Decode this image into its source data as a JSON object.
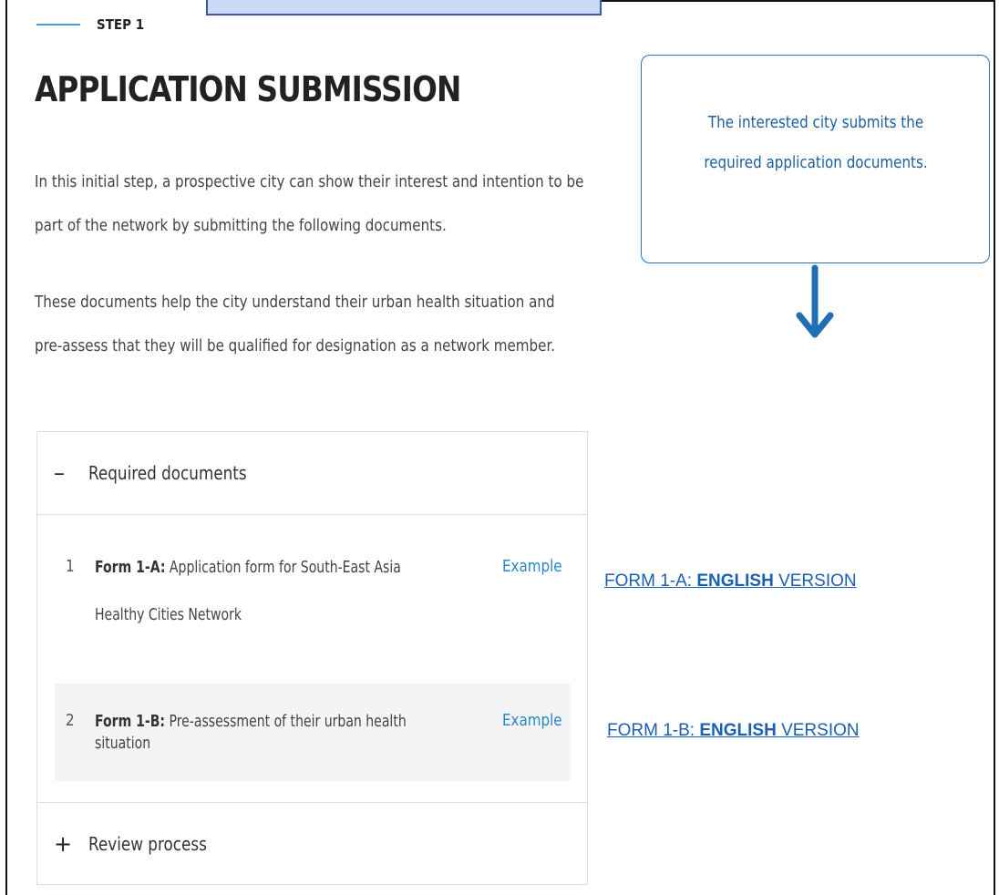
{
  "step": {
    "label": "STEP 1"
  },
  "page": {
    "title": "APPLICATION SUBMISSION",
    "intro_1": "In this initial step, a prospective city can show their interest and intention to be part of the network by submitting the following documents.",
    "intro_2": "These documents help the city understand their urban health situation and pre-assess that they will be qualified for designation as a network member."
  },
  "callout": {
    "text": "The interested city submits the required application documents."
  },
  "accordion": {
    "required": {
      "sign": "–",
      "label": "Required documents"
    },
    "documents": [
      {
        "number": "1",
        "name": "Form 1-A:",
        "description": "Application form for South-East Asia Healthy Cities Network",
        "example": "Example"
      },
      {
        "number": "2",
        "name": "Form 1-B:",
        "description": "Pre-assessment of their urban health situation",
        "example": "Example"
      }
    ],
    "review": {
      "sign": "+",
      "label": "Review process"
    }
  },
  "links": [
    {
      "prefix": "FORM 1-A: ",
      "bold": "ENGLISH",
      "suffix": " VERSION"
    },
    {
      "prefix": "FORM 1-B: ",
      "bold": "ENGLISH",
      "suffix": " VERSION"
    }
  ],
  "colors": {
    "accent": "#2a74b8",
    "link": "#1b5fb0",
    "example": "#2a86c8",
    "tab": "#c9daf4"
  },
  "icons": {
    "callout_arrow": "arrow-down-icon"
  }
}
